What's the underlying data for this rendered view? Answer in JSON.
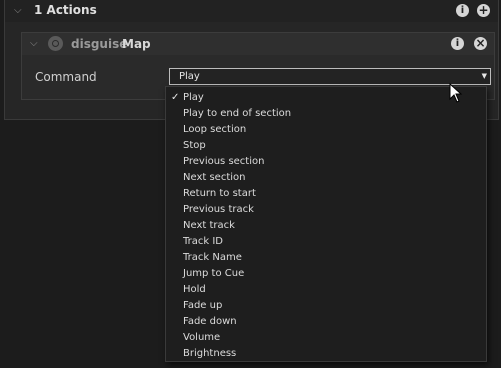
{
  "actions_header": {
    "title": "1 Actions",
    "info_glyph": "i",
    "add_glyph": "+"
  },
  "action": {
    "brand": "disguise",
    "name": "Map",
    "info_glyph": "i",
    "close_glyph": "×"
  },
  "command": {
    "label": "Command",
    "selected": "Play",
    "arrow": "▼"
  },
  "dropdown": {
    "check_glyph": "✓",
    "options": [
      "Play",
      "Play to end of section",
      "Loop section",
      "Stop",
      "Previous section",
      "Next section",
      "Return to start",
      "Previous track",
      "Next track",
      "Track ID",
      "Track Name",
      "Jump to Cue",
      "Hold",
      "Fade up",
      "Fade down",
      "Volume",
      "Brightness"
    ]
  },
  "icons": {
    "collapse": "chevron-down-icon",
    "info": "info-icon",
    "add": "plus-icon",
    "remove": "close-icon",
    "brand": "disguise-logo-icon",
    "pointer": "mouse-pointer-icon"
  }
}
